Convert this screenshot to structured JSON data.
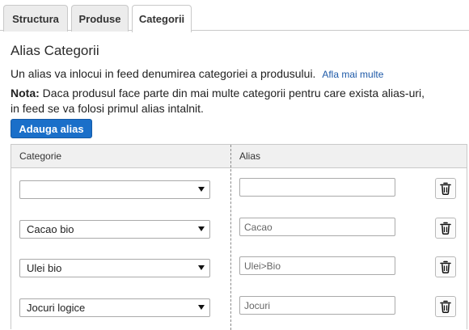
{
  "tabs": [
    {
      "label": "Structura",
      "active": false
    },
    {
      "label": "Produse",
      "active": false
    },
    {
      "label": "Categorii",
      "active": true
    }
  ],
  "title": "Alias Categorii",
  "description": "Un alias va inlocui in feed denumirea categoriei a produsului.",
  "learn_more_link": "Afla mai multe",
  "note": {
    "label": "Nota:",
    "line1": "Daca produsul face parte din mai multe categorii pentru care exista alias-uri,",
    "line2": "in feed se va folosi primul alias intalnit."
  },
  "add_button_label": "Adauga alias",
  "table": {
    "headers": {
      "category": "Categorie",
      "alias": "Alias"
    },
    "rows": [
      {
        "category": "",
        "alias_placeholder": ""
      },
      {
        "category": "Cacao bio",
        "alias_placeholder": "Cacao"
      },
      {
        "category": "Ulei bio",
        "alias_placeholder": "Ulei>Bio"
      },
      {
        "category": "Jocuri logice",
        "alias_placeholder": "Jocuri"
      }
    ]
  },
  "icons": {
    "delete": "trash-icon",
    "dropdown": "chevron-down-icon"
  },
  "colors": {
    "primary_button": "#1a6fc9",
    "link": "#1e5aa8"
  }
}
